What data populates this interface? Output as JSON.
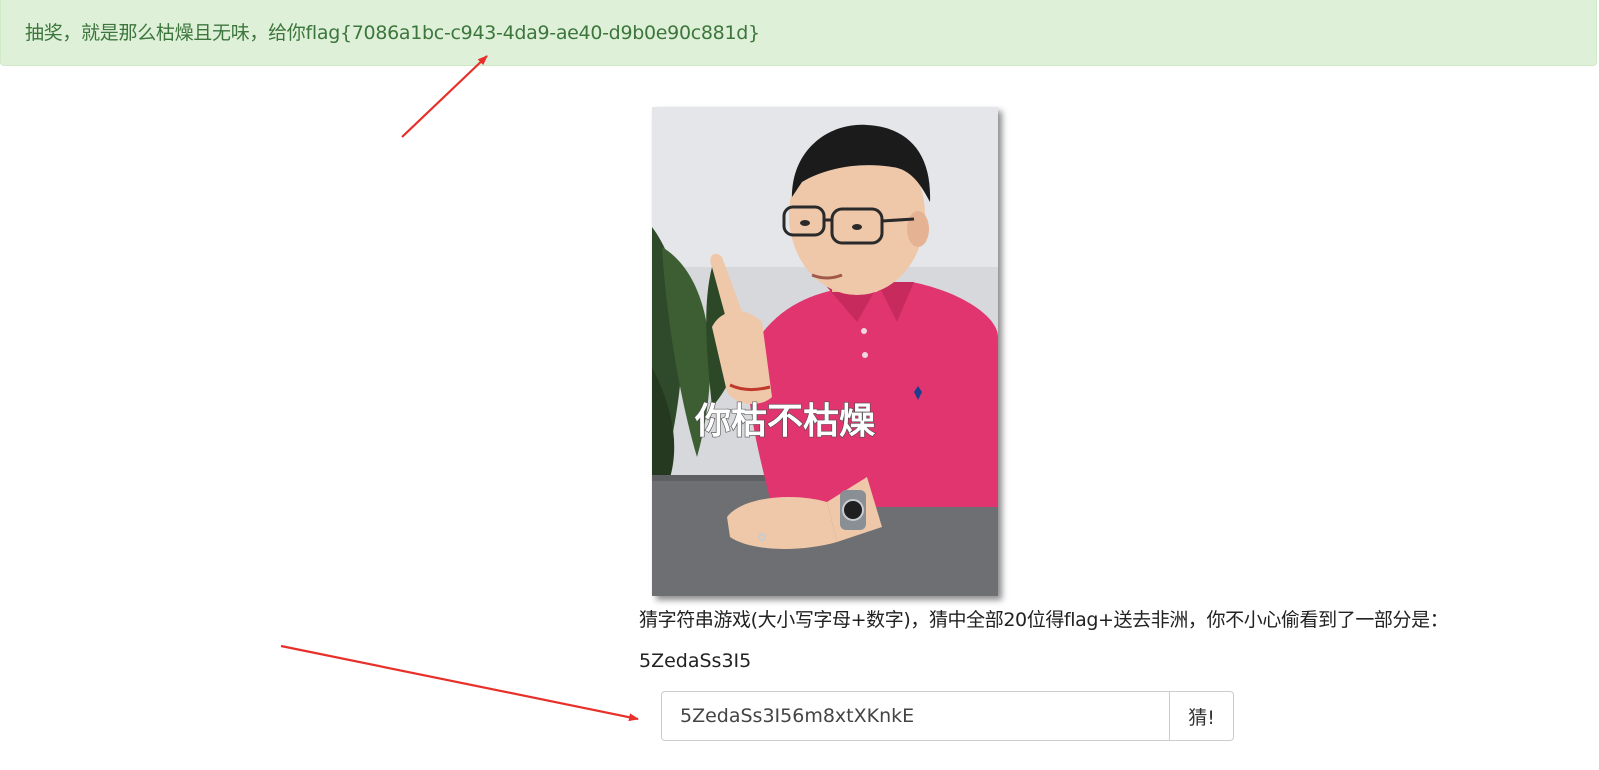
{
  "alert": {
    "message": "抽奖，就是那么枯燥且无味，给你flag{7086a1bc-c943-4da9-ae40-d9b0e90c881d}"
  },
  "photo": {
    "caption": "你枯不枯燥"
  },
  "game": {
    "prompt": "猜字符串游戏(大小写字母+数字)，猜中全部20位得flag+送去非洲，你不小心偷看到了一部分是：",
    "partial": "5ZedaSs3I5",
    "input_value": "5ZedaSs3I56m8xtXKnkE",
    "button_label": "猜!"
  },
  "colors": {
    "alert_bg": "#dff0d8",
    "alert_text": "#3c763d",
    "arrow": "#e8302a",
    "shirt": "#e0356e"
  }
}
